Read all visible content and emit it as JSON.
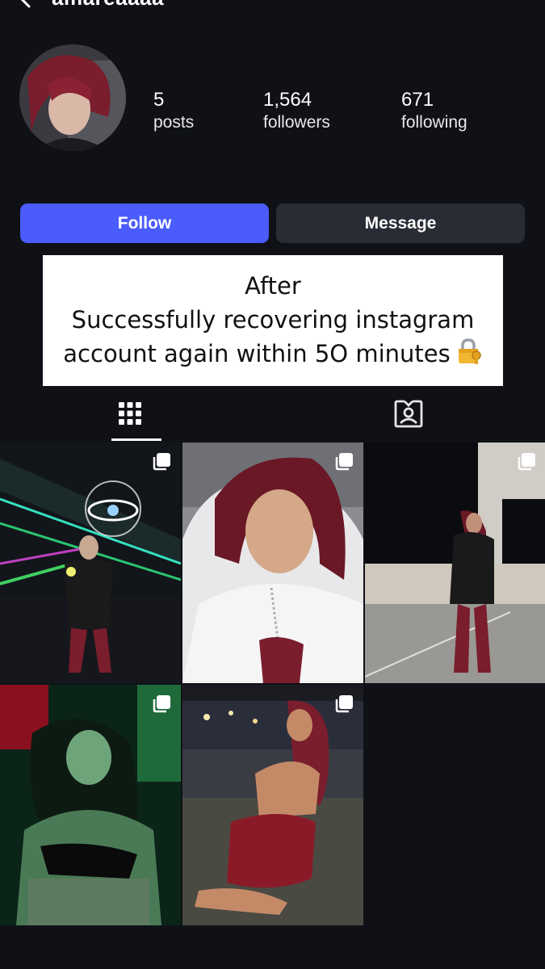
{
  "header": {
    "username": "amareaaaa"
  },
  "profile": {
    "stats": [
      {
        "value": "5",
        "label": "posts"
      },
      {
        "value": "1,564",
        "label": "followers"
      },
      {
        "value": "671",
        "label": "following"
      }
    ]
  },
  "actions": {
    "follow_label": "Follow",
    "message_label": "Message"
  },
  "caption": {
    "lines": [
      "After",
      "Successfully recovering instagram",
      "account again within 5O minutes"
    ],
    "emoji": "lock-with-key"
  },
  "tabs": [
    {
      "icon": "grid-icon",
      "active": true
    },
    {
      "icon": "tagged-person-icon",
      "active": false
    }
  ],
  "posts": [
    {
      "icon": "multi-photo-icon",
      "scene": "nightclub with neon eye sign"
    },
    {
      "icon": "multi-photo-icon",
      "scene": "selfie in white top"
    },
    {
      "icon": "multi-photo-icon",
      "scene": "rooftop at night, red boots"
    },
    {
      "icon": "multi-photo-icon",
      "scene": "green-lit club"
    },
    {
      "icon": "multi-photo-icon",
      "scene": "beach at night, red dress"
    }
  ],
  "colors": {
    "background": "#0f1117",
    "follow_button": "#4a5cfc",
    "message_button": "#2a2c35",
    "hair": "#7a1d2c"
  }
}
